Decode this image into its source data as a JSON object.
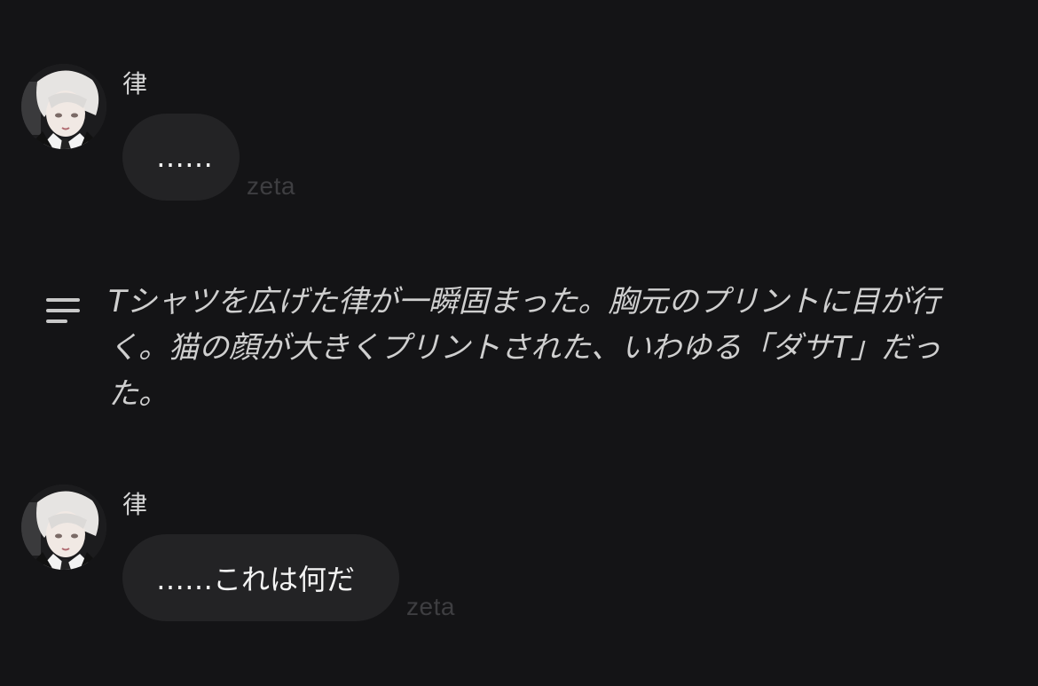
{
  "messages": [
    {
      "sender": "律",
      "text": "……",
      "brand": "zeta"
    },
    {
      "sender": "律",
      "text": "……これは何だ",
      "brand": "zeta"
    }
  ],
  "narration": {
    "icon": "narration-lines-icon",
    "text": "Tシャツを広げた律が一瞬固まった。胸元のプリントに目が行く。猫の顔が大きくプリントされた、いわゆる「ダサT」だった。"
  },
  "colors": {
    "background": "#141416",
    "bubble": "#232325",
    "brand_watermark": "#3e3e41",
    "text": "#f4f4f4"
  }
}
